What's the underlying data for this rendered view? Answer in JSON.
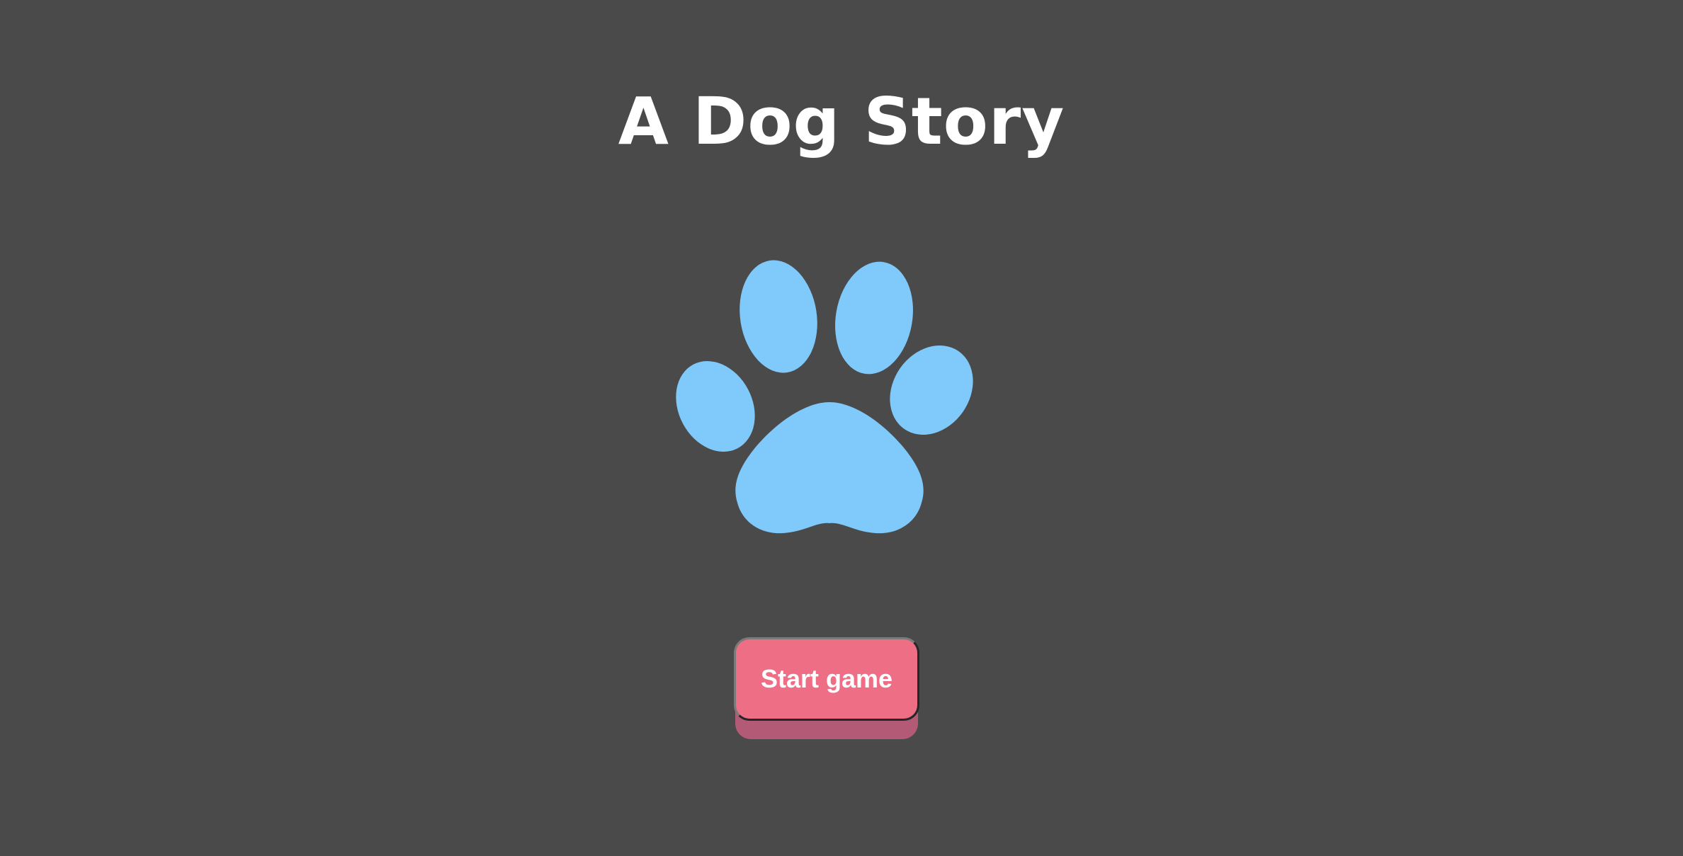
{
  "game": {
    "title": "A Dog Story",
    "start_button_label": "Start game"
  },
  "icons": {
    "logo": "paw-print-icon"
  },
  "colors": {
    "background": "#4a4a4a",
    "title_text": "#ffffff",
    "paw": "#80c9fb",
    "button": "#ee6e85",
    "button_shadow": "#b35a77",
    "button_text": "#ffffff"
  }
}
